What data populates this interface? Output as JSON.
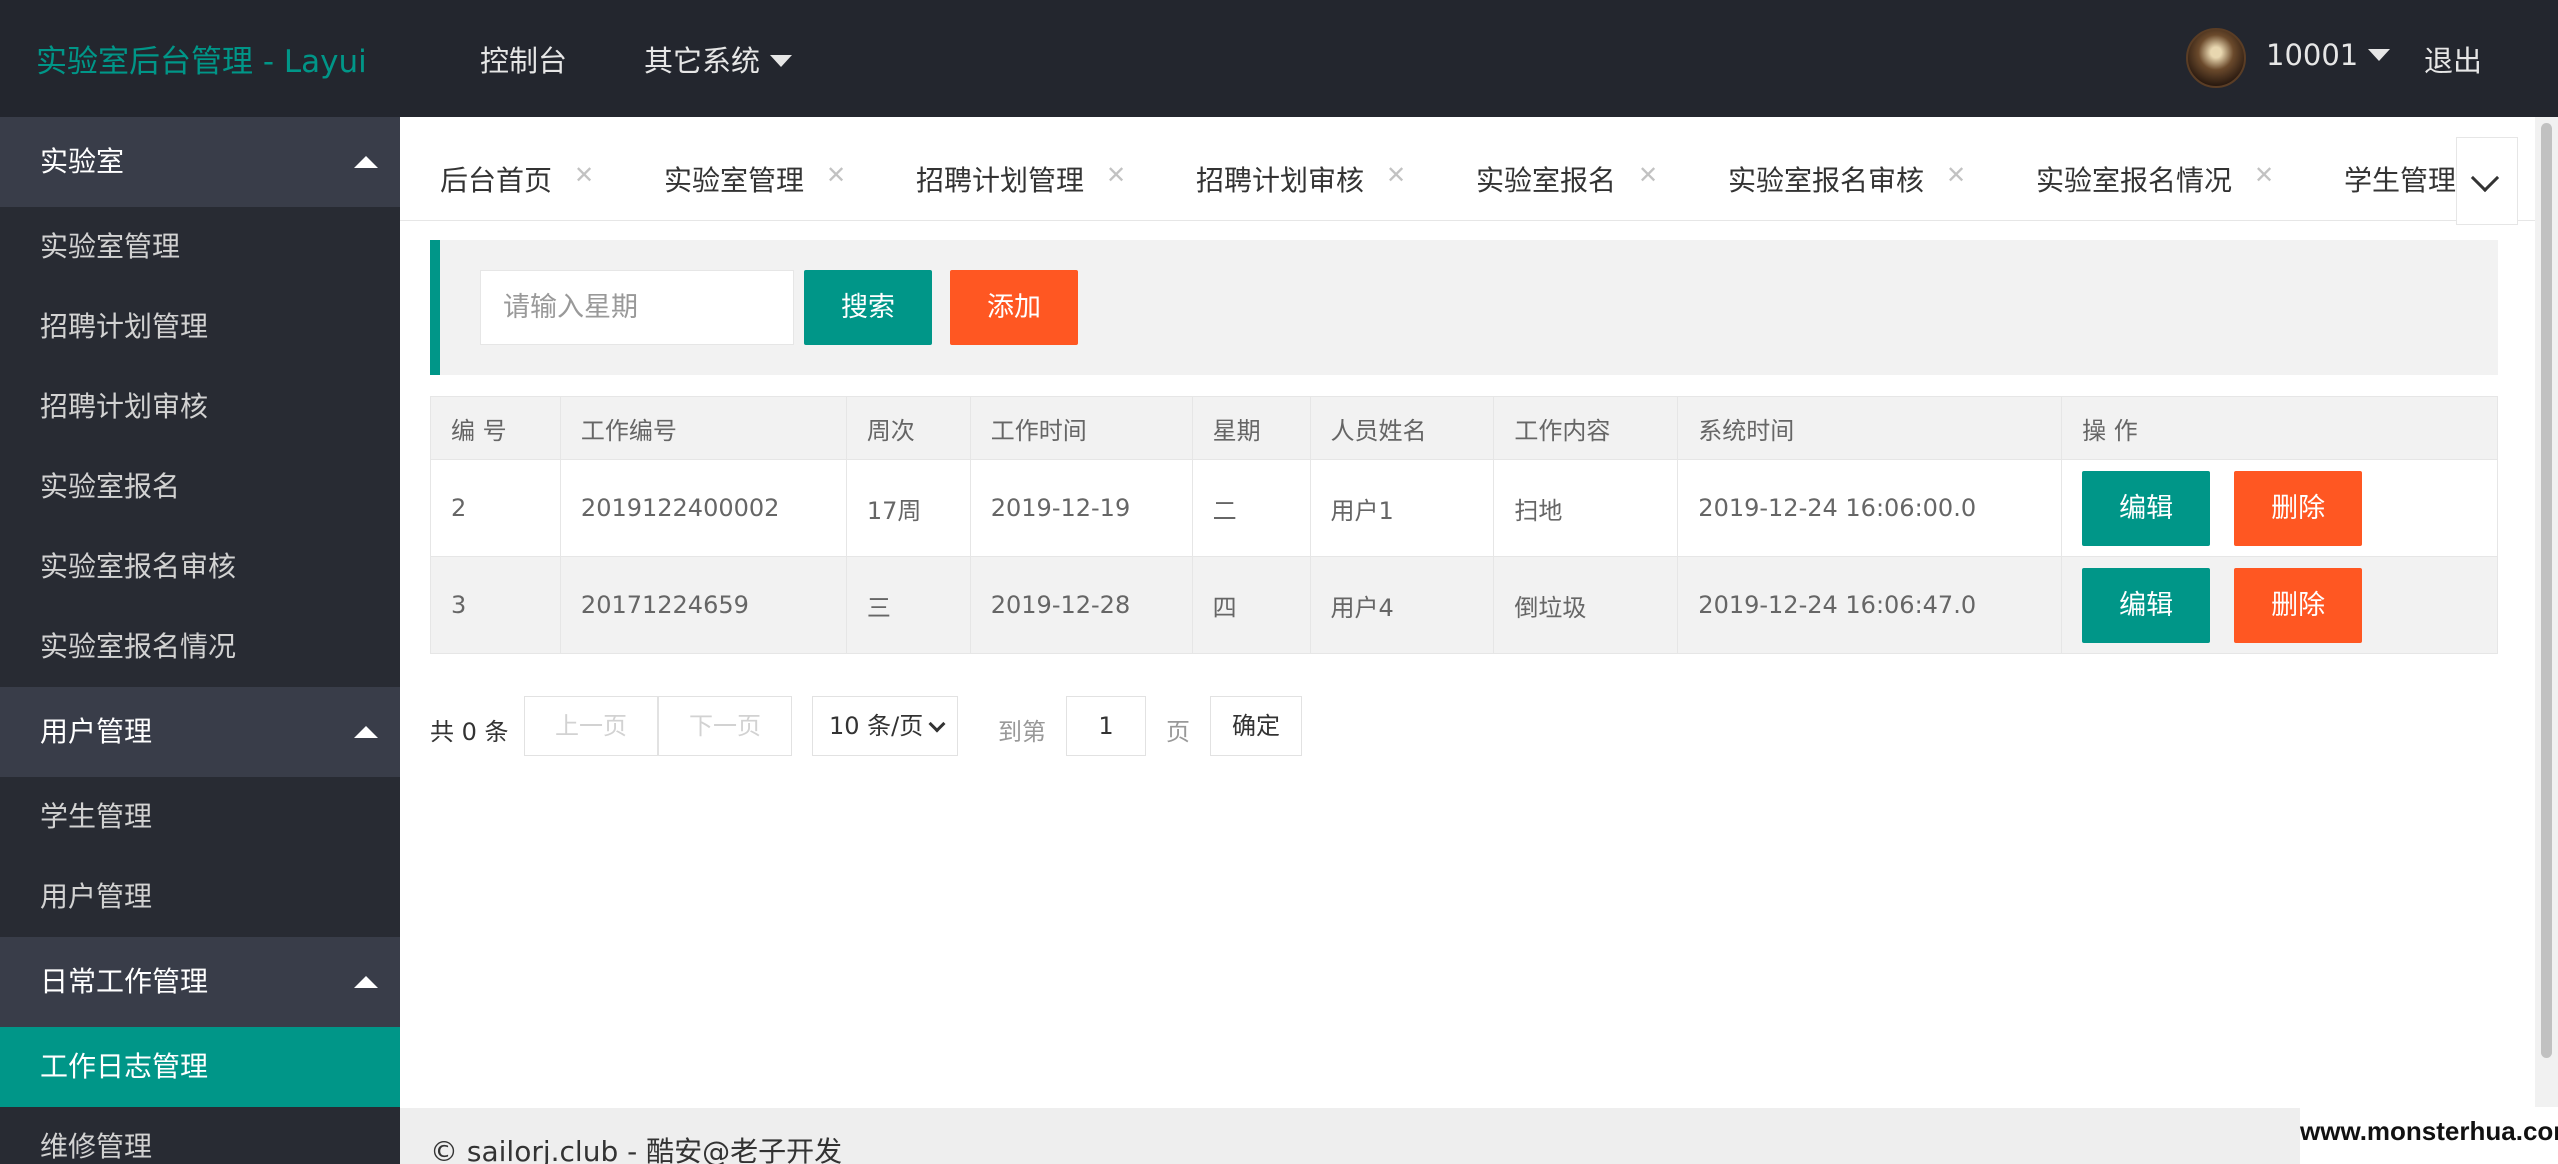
{
  "header": {
    "logo": "实验室后台管理 - Layui",
    "nav": [
      "控制台",
      "其它系统"
    ],
    "user": "10001",
    "logout": "退出"
  },
  "sidebar": {
    "groups": [
      {
        "label": "实验室",
        "items": [
          "实验室管理",
          "招聘计划管理",
          "招聘计划审核",
          "实验室报名",
          "实验室报名审核",
          "实验室报名情况"
        ]
      },
      {
        "label": "用户管理",
        "items": [
          "学生管理",
          "用户管理"
        ]
      },
      {
        "label": "日常工作管理",
        "items": [
          "工作日志管理",
          "维修管理"
        ]
      }
    ],
    "active": "工作日志管理"
  },
  "tabs": [
    "后台首页",
    "实验室管理",
    "招聘计划管理",
    "招聘计划审核",
    "实验室报名",
    "实验室报名审核",
    "实验室报名情况",
    "学生管理"
  ],
  "search": {
    "placeholder": "请输入星期",
    "search_label": "搜索",
    "add_label": "添加"
  },
  "table": {
    "columns": [
      "编 号",
      "工作编号",
      "周次",
      "工作时间",
      "星期",
      "人员姓名",
      "工作内容",
      "系统时间",
      "操 作"
    ],
    "rows": [
      [
        "2",
        "2019122400002",
        "17周",
        "2019-12-19",
        "二",
        "用户1",
        "扫地",
        "2019-12-24 16:06:00.0"
      ],
      [
        "3",
        "20171224659",
        "三",
        "2019-12-28",
        "四",
        "用户4",
        "倒垃圾",
        "2019-12-24 16:06:47.0"
      ]
    ],
    "edit_label": "编辑",
    "delete_label": "删除"
  },
  "pager": {
    "count": "共 0 条",
    "prev": "上一页",
    "next": "下一页",
    "size": "10 条/页",
    "goto": "到第",
    "page_value": "1",
    "page_suffix": "页",
    "ok": "确定"
  },
  "footer": {
    "text": "© sailorj.club - 酷安@老子开发",
    "watermark": "www.monsterhua.com"
  },
  "colors": {
    "accent": "#009688",
    "danger": "#ff5722",
    "header_bg": "#23262e",
    "sidebar_bg": "#393d49"
  }
}
